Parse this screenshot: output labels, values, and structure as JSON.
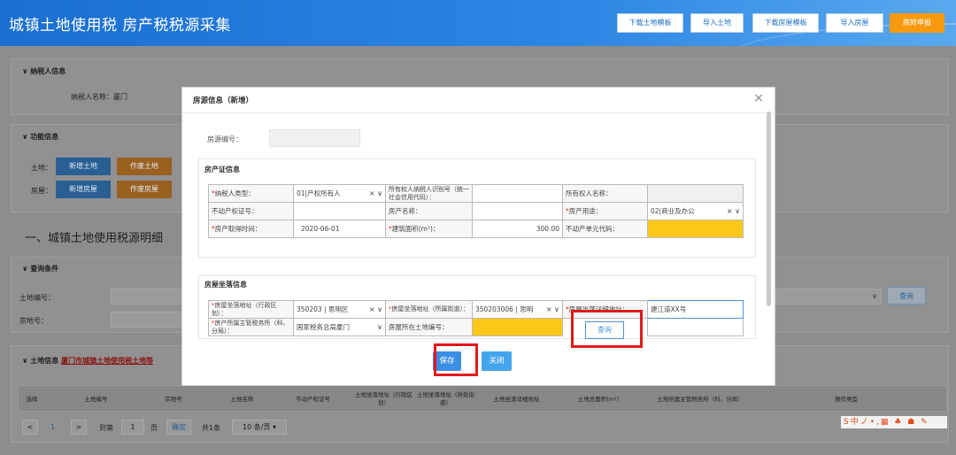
{
  "header": {
    "title": "城镇土地使用税 房产税税源采集",
    "buttons": [
      "下载土地模板",
      "导入土地",
      "下载房屋模板",
      "导入房屋",
      "跳转申报"
    ]
  },
  "background": {
    "taxpayer_section": "纳税人信息",
    "taxpayer_name_label": "纳税人名称：厦门",
    "function_section": "功能信息",
    "land_label": "土地：",
    "land_add": "新增土地",
    "land_void": "作废土地",
    "house_label": "房屋：",
    "house_add": "新增房屋",
    "house_void": "作废房屋",
    "big_title": "一、城镇土地使用税源明细",
    "query_section": "查询条件",
    "land_no_label": "土地编号：",
    "parcel_no_label": "宗地号：",
    "query_button": "查询",
    "land_info_section": "土地信息",
    "land_info_link": "厦门市城镇土地使用税土地等",
    "table_headers": [
      "选择",
      "土地编号",
      "宗地号",
      "土地名称",
      "不动产权证号",
      "土地坐落地址（行政区划）",
      "土地坐落地址（所处街道）",
      "土地坐落详细地址",
      "土地总面积(m²)",
      "土地所属主管税务所（科、分局）",
      "操作类型"
    ],
    "pager": {
      "prev": "<",
      "page": "1",
      "next": ">",
      "goto": "到第",
      "goto_page": "1",
      "page_unit": "页",
      "confirm": "确定",
      "total": "共1条",
      "per_page": "10 条/页 ▾"
    },
    "ime": "S中ノ•,▦ ♣ ☗ ✎"
  },
  "modal": {
    "title": "房源信息（新增）",
    "close": "×",
    "house_no_label": "房源编号：",
    "cert_section": "房产证信息",
    "cert_rows": [
      {
        "l1": "纳税人类型：",
        "v1": "01|产权所有人",
        "l2": "所有权人纳税人识别号（统一社会信用代码）：",
        "v2": "",
        "l3": "所有权人名称：",
        "v3": ""
      },
      {
        "l1": "不动产权证号：",
        "v1": "",
        "l2": "房产名称：",
        "v2": "",
        "l3": "房产用途：",
        "v3": "02|商业及办公"
      },
      {
        "l1": "房产取得时间：",
        "v1": "2020-06-01",
        "l2": "建筑面积(m²)：",
        "v2": "300.00",
        "l3": "不动产单元代码：",
        "v3": ""
      }
    ],
    "location_section": "房屋坐落信息",
    "loc_rows": [
      {
        "l1": "房屋坐落地址（行政区划）：",
        "v1": "350203 | 思明区",
        "l2": "房屋坐落地址（所属街道）：",
        "v2": "350203006 | 思明",
        "l3": "房屋坐落详细地址：",
        "v3": "建江道XX号"
      },
      {
        "l1": "房产所属主管税务所（科、分局）：",
        "v1": "国家税务总局厦门",
        "l2": "房屋所在土地编号：",
        "v2": "",
        "query_button": "查询"
      }
    ],
    "save_button": "保存",
    "close_button": "关闭"
  },
  "colors": {
    "header_blue": "#1a6fd1",
    "accent_orange": "#f79a10",
    "required_yellow": "#fdc719",
    "highlight_red": "#e2181b",
    "button_blue": "#3a8ee6"
  }
}
